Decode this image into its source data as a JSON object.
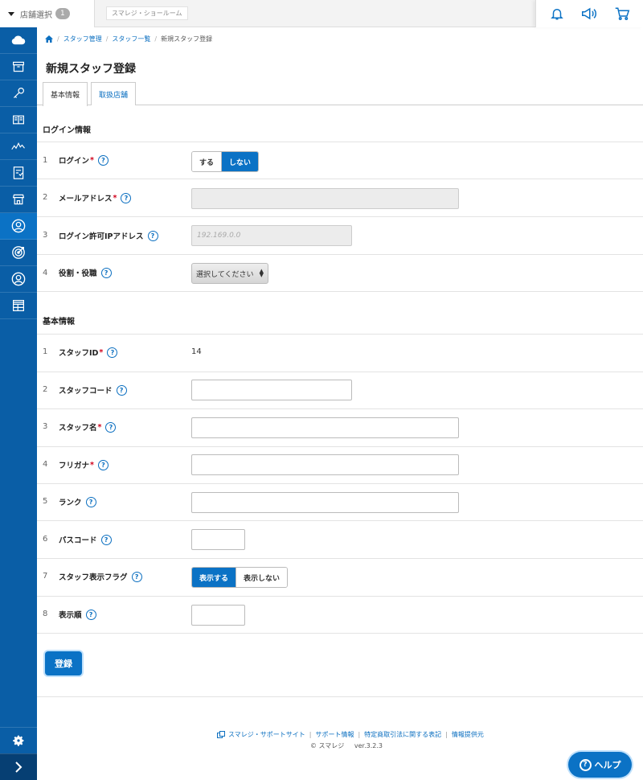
{
  "topbar": {
    "store_select_label": "店舗選択",
    "store_select_count": "1",
    "store_tag": "スマレジ・ショールーム",
    "icons": [
      "bell-icon",
      "megaphone-icon",
      "cart-icon"
    ]
  },
  "sidebar": {
    "items": [
      "cloud-icon",
      "box-icon",
      "key-icon",
      "book-icon",
      "chart-icon",
      "report-icon",
      "store-icon",
      "staff-icon",
      "target-icon",
      "user-icon",
      "grid-icon"
    ],
    "active_index": 7,
    "bottom": [
      "gear-icon",
      "chevron-right-icon"
    ]
  },
  "breadcrumb": {
    "items": [
      "スタッフ管理",
      "スタッフ一覧",
      "新規スタッフ登録"
    ]
  },
  "page_title": "新規スタッフ登録",
  "tabs": [
    "基本情報",
    "取扱店舗"
  ],
  "login_section": {
    "title": "ログイン情報",
    "rows": [
      {
        "num": "1",
        "label": "ログイン",
        "required": "*",
        "toggle": [
          "する",
          "しない"
        ],
        "selected": "しない"
      },
      {
        "num": "2",
        "label": "メールアドレス",
        "required": "*",
        "value": ""
      },
      {
        "num": "3",
        "label": "ログイン許可IPアドレス",
        "placeholder": "192.169.0.0"
      },
      {
        "num": "4",
        "label": "役割・役職",
        "select": "選択してください"
      }
    ]
  },
  "basic_section": {
    "title": "基本情報",
    "rows": [
      {
        "num": "1",
        "label": "スタッフID",
        "required": "*",
        "value": "14"
      },
      {
        "num": "2",
        "label": "スタッフコード",
        "value": ""
      },
      {
        "num": "3",
        "label": "スタッフ名",
        "required": "*",
        "value": ""
      },
      {
        "num": "4",
        "label": "フリガナ",
        "required": "*",
        "value": ""
      },
      {
        "num": "5",
        "label": "ランク",
        "value": ""
      },
      {
        "num": "6",
        "label": "パスコード",
        "value": ""
      },
      {
        "num": "7",
        "label": "スタッフ表示フラグ",
        "toggle": [
          "表示する",
          "表示しない"
        ],
        "selected": "表示する"
      },
      {
        "num": "8",
        "label": "表示順",
        "value": ""
      }
    ]
  },
  "register_button": "登録",
  "help_char": "?",
  "footer": {
    "links": [
      "スマレジ・サポートサイト",
      "サポート情報",
      "特定商取引法に関する表記",
      "情報提供元"
    ],
    "copyright": "© スマレジ",
    "version": "ver.3.2.3"
  },
  "help_button": "ヘルプ",
  "colors": {
    "primary": "#0b72c5",
    "sidebar": "#0a5ea6",
    "required": "#d0021b"
  }
}
